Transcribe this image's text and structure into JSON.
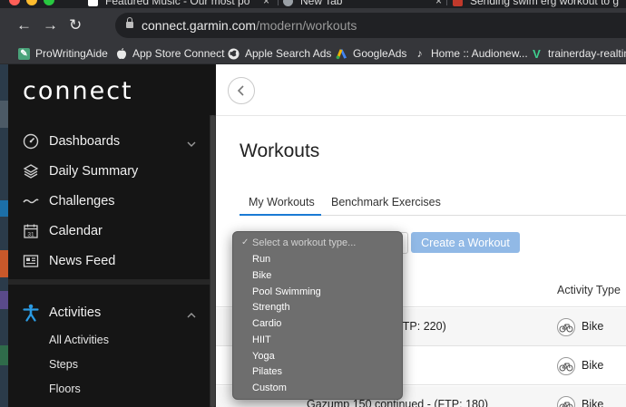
{
  "browser": {
    "tabs": [
      {
        "title": "Featured Music - Our most po",
        "favicon_color": "#ffffff"
      },
      {
        "title": "New Tab",
        "favicon_color": "#9aa0a6"
      },
      {
        "title": "Sending swim erg workout to g",
        "favicon_color": "#c0392b"
      }
    ],
    "tab_close_glyph": "×",
    "url_host": "connect.garmin.com",
    "url_path": "/modern/workouts",
    "nav": {
      "back": "←",
      "forward": "→",
      "reload": "↻"
    },
    "bookmarks": [
      {
        "label": "ProWritingAide",
        "icon": "prowritingaid-icon",
        "color": "#4aa37a"
      },
      {
        "label": "App Store Connect",
        "icon": "apple-icon",
        "color": "#e8e8e8"
      },
      {
        "label": "Apple Search Ads",
        "icon": "globe-icon",
        "color": "#e8e8e8"
      },
      {
        "label": "GoogleAds",
        "icon": "google-ads-icon",
        "color": "#f4b400"
      },
      {
        "label": "Home :: Audionew...",
        "icon": "note-icon",
        "color": "#e8e8e8"
      },
      {
        "label": "trainerday-realtim",
        "icon": "v-icon",
        "color": "#3ecf8e"
      }
    ]
  },
  "sidebar": {
    "logo": "connect",
    "items": [
      {
        "label": "Dashboards",
        "icon": "speedometer-icon",
        "has_chevron": true,
        "chevron": "down"
      },
      {
        "label": "Daily Summary",
        "icon": "layers-icon",
        "has_chevron": false
      },
      {
        "label": "Challenges",
        "icon": "wave-icon",
        "has_chevron": false
      },
      {
        "label": "Calendar",
        "icon": "calendar-icon",
        "has_chevron": false,
        "badge": "31"
      },
      {
        "label": "News Feed",
        "icon": "news-icon",
        "has_chevron": false
      }
    ],
    "activities": {
      "label": "Activities",
      "icon": "person-icon",
      "accent": "#2b9be3",
      "chevron": "up",
      "sub_items": [
        "All Activities",
        "Steps",
        "Floors"
      ]
    }
  },
  "main": {
    "title": "Workouts",
    "tabs": [
      {
        "label": "My Workouts",
        "active": true
      },
      {
        "label": "Benchmark Exercises",
        "active": false
      }
    ],
    "create_button": "Create a Workout",
    "table": {
      "activity_type_header": "Activity Type",
      "rows": [
        {
          "name": "(FTP: 220)",
          "type": "Bike"
        },
        {
          "name": "",
          "type": "Bike"
        },
        {
          "name": "Gazump 150 continued - (FTP: 180)",
          "type": "Bike"
        }
      ]
    }
  },
  "dropdown": {
    "check_glyph": "✓",
    "placeholder": "Select a workout type...",
    "options": [
      "Run",
      "Bike",
      "Pool Swimming",
      "Strength",
      "Cardio",
      "HIIT",
      "Yoga",
      "Pilates",
      "Custom"
    ]
  },
  "colors": {
    "accent_blue": "#1a7ad4",
    "button_blue": "#91b9e6",
    "sidebar_bg": "#151515"
  }
}
